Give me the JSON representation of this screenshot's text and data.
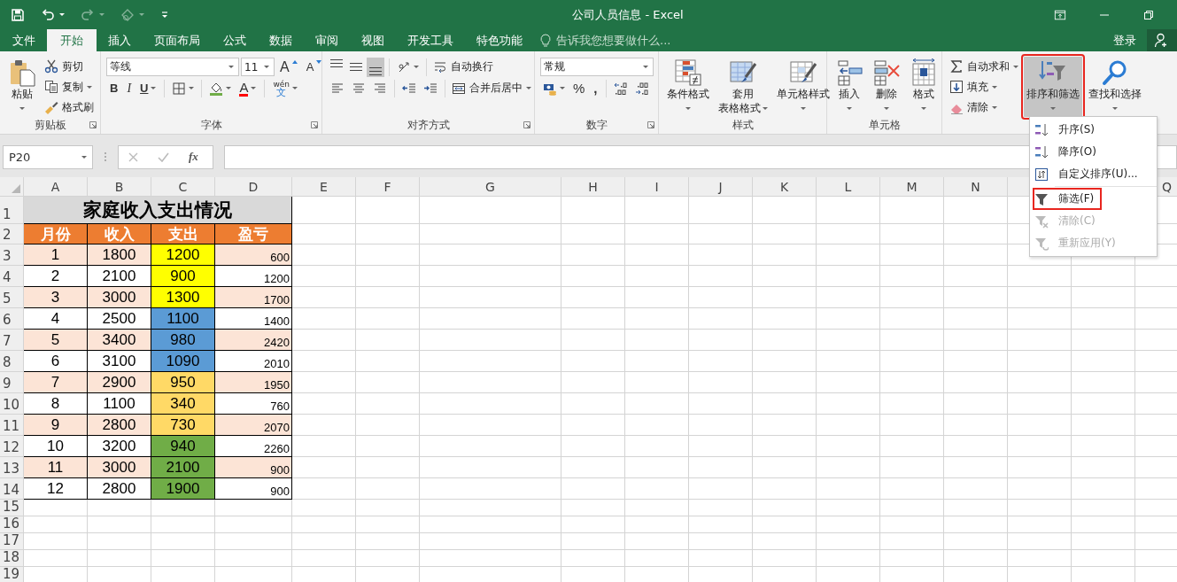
{
  "window": {
    "title": "公司人员信息 - Excel"
  },
  "quick_access": [
    {
      "kind": "save",
      "disabled": false
    },
    {
      "kind": "undo",
      "disabled": false
    },
    {
      "kind": "redo",
      "disabled": true
    },
    {
      "kind": "touch-mode",
      "disabled": true
    },
    {
      "kind": "customize",
      "disabled": false
    }
  ],
  "ribbon_tabs": [
    {
      "label": "文件",
      "selected": false
    },
    {
      "label": "开始",
      "selected": true
    },
    {
      "label": "插入",
      "selected": false
    },
    {
      "label": "页面布局",
      "selected": false
    },
    {
      "label": "公式",
      "selected": false
    },
    {
      "label": "数据",
      "selected": false
    },
    {
      "label": "审阅",
      "selected": false
    },
    {
      "label": "视图",
      "selected": false
    },
    {
      "label": "开发工具",
      "selected": false
    },
    {
      "label": "特色功能",
      "selected": false
    }
  ],
  "tell_me": {
    "placeholder": "告诉我您想要做什么..."
  },
  "account": {
    "sign_in": "登录"
  },
  "ribbon_groups": [
    {
      "label": "剪贴板",
      "launcher": true,
      "columns": [
        [
          [
            {
              "kind": "paste",
              "label": "粘贴",
              "caret": true
            }
          ]
        ],
        [
          [
            {
              "kind": "cut",
              "label": "剪切"
            }
          ],
          [
            {
              "kind": "copy",
              "label": "复制",
              "caret": true
            }
          ],
          [
            {
              "kind": "format-painter",
              "label": "格式刷"
            }
          ]
        ]
      ]
    },
    {
      "label": "字体",
      "launcher": true,
      "columns": [
        [
          [
            {
              "kind": "font-name",
              "value": "等线"
            },
            {
              "kind": "font-size",
              "value": "11"
            },
            {
              "kind": "grow-font",
              "label": "A"
            },
            {
              "kind": "shrink-font",
              "label": "A"
            }
          ],
          [
            {
              "kind": "bold",
              "label": "B"
            },
            {
              "kind": "italic",
              "label": "I"
            },
            {
              "kind": "underline",
              "label": "U",
              "caret": true
            },
            {
              "kind": "separator"
            },
            {
              "kind": "borders",
              "caret": true
            },
            {
              "kind": "separator"
            },
            {
              "kind": "fill-color",
              "caret": true
            },
            {
              "kind": "font-color",
              "label": "A",
              "caret": true
            },
            {
              "kind": "separator"
            },
            {
              "kind": "phonetic",
              "label": "wén",
              "sublabel": "文",
              "caret": true
            }
          ]
        ]
      ]
    },
    {
      "label": "对齐方式",
      "launcher": true,
      "columns": [
        [
          [
            {
              "kind": "align-top",
              "selected": false
            },
            {
              "kind": "align-middle",
              "selected": false
            },
            {
              "kind": "align-bottom",
              "selected": true
            },
            {
              "kind": "separator"
            },
            {
              "kind": "orientation",
              "caret": true
            },
            {
              "kind": "separator"
            },
            {
              "kind": "wrap-text",
              "label": "自动换行"
            }
          ],
          [
            {
              "kind": "align-left",
              "selected": false
            },
            {
              "kind": "align-center",
              "selected": false
            },
            {
              "kind": "align-right",
              "selected": false
            },
            {
              "kind": "separator"
            },
            {
              "kind": "indent-decrease"
            },
            {
              "kind": "indent-increase"
            },
            {
              "kind": "separator"
            },
            {
              "kind": "merge",
              "label": "合并后居中",
              "caret": true
            }
          ]
        ]
      ]
    },
    {
      "label": "数字",
      "launcher": true,
      "columns": [
        [
          [
            {
              "kind": "number-format",
              "value": "常规"
            }
          ],
          [
            {
              "kind": "accounting",
              "caret": true
            },
            {
              "kind": "percent",
              "label": "%"
            },
            {
              "kind": "comma",
              "label": ","
            },
            {
              "kind": "separator"
            },
            {
              "kind": "decimal-increase"
            },
            {
              "kind": "decimal-decrease"
            }
          ]
        ]
      ]
    },
    {
      "label": "样式",
      "columns": [
        [
          [
            {
              "kind": "conditional-format",
              "label": "条件格式",
              "caret": true
            }
          ]
        ],
        [
          [
            {
              "kind": "table-format",
              "label": "套用",
              "label_2": "表格格式",
              "caret": true
            }
          ]
        ],
        [
          [
            {
              "kind": "cell-styles",
              "label": "单元格样式",
              "caret": true
            }
          ]
        ]
      ]
    },
    {
      "label": "单元格",
      "columns": [
        [
          [
            {
              "kind": "insert-cells",
              "label": "插入",
              "caret": true
            }
          ]
        ],
        [
          [
            {
              "kind": "delete-cells",
              "label": "删除",
              "caret": true
            }
          ]
        ],
        [
          [
            {
              "kind": "format-cells",
              "label": "格式",
              "caret": true
            }
          ]
        ]
      ]
    },
    {
      "columns": [
        [
          [
            {
              "kind": "autosum",
              "label": "自动求和",
              "caret": true
            }
          ],
          [
            {
              "kind": "fill",
              "label": "填充",
              "caret": true
            }
          ],
          [
            {
              "kind": "clear",
              "label": "清除",
              "caret": true
            }
          ]
        ],
        [
          [
            {
              "kind": "sort-filter",
              "label": "排序和筛选",
              "caret": true,
              "active": true,
              "highlighted": true
            }
          ]
        ],
        [
          [
            {
              "kind": "find-select",
              "label": "查找和选择",
              "caret": true
            }
          ]
        ]
      ]
    }
  ],
  "formula_bar": {
    "name_box": "P20",
    "function_button": "fx"
  },
  "sheet": {
    "columns": [
      "A",
      "B",
      "C",
      "D",
      "E",
      "F",
      "G",
      "H",
      "I",
      "J",
      "K",
      "L",
      "M",
      "N"
    ],
    "last_column": "Q",
    "row_numbers": [
      "1",
      "2",
      "3",
      "4",
      "5",
      "6",
      "7",
      "8",
      "9",
      "10",
      "11",
      "12",
      "13",
      "14",
      "15",
      "16",
      "17",
      "18",
      "19"
    ],
    "title": "家庭收入支出情况",
    "headers": [
      "月份",
      "收入",
      "支出",
      "盈亏"
    ],
    "rows": [
      {
        "cells": [
          "1",
          "1800",
          "1200",
          "600"
        ],
        "shaded": true,
        "color": "#ffff00"
      },
      {
        "cells": [
          "2",
          "2100",
          "900",
          "1200"
        ],
        "shaded": false,
        "color": "#ffff00"
      },
      {
        "cells": [
          "3",
          "3000",
          "1300",
          "1700"
        ],
        "shaded": true,
        "color": "#ffff00"
      },
      {
        "cells": [
          "4",
          "2500",
          "1100",
          "1400"
        ],
        "shaded": false,
        "color": "#5b9bd5"
      },
      {
        "cells": [
          "5",
          "3400",
          "980",
          "2420"
        ],
        "shaded": true,
        "color": "#5b9bd5"
      },
      {
        "cells": [
          "6",
          "3100",
          "1090",
          "2010"
        ],
        "shaded": false,
        "color": "#5b9bd5"
      },
      {
        "cells": [
          "7",
          "2900",
          "950",
          "1950"
        ],
        "shaded": true,
        "color": "#ffd966"
      },
      {
        "cells": [
          "8",
          "1100",
          "340",
          "760"
        ],
        "shaded": false,
        "color": "#ffd966"
      },
      {
        "cells": [
          "9",
          "2800",
          "730",
          "2070"
        ],
        "shaded": true,
        "color": "#ffd966"
      },
      {
        "cells": [
          "10",
          "3200",
          "940",
          "2260"
        ],
        "shaded": false,
        "color": "#70ad47"
      },
      {
        "cells": [
          "11",
          "3000",
          "2100",
          "900"
        ],
        "shaded": true,
        "color": "#70ad47"
      },
      {
        "cells": [
          "12",
          "2800",
          "1900",
          "900"
        ],
        "shaded": false,
        "color": "#70ad47"
      }
    ]
  },
  "sort_menu": {
    "items": [
      {
        "kind": "sort-ascending",
        "label": "升序(S)",
        "disabled": false
      },
      {
        "kind": "sort-descending",
        "label": "降序(O)",
        "disabled": false
      },
      {
        "kind": "custom-sort",
        "label": "自定义排序(U)...",
        "disabled": false
      },
      {
        "kind": "filter",
        "label": "筛选(F)",
        "disabled": false,
        "divider_before": true,
        "highlighted": true
      },
      {
        "kind": "clear-filter",
        "label": "清除(C)",
        "disabled": true
      },
      {
        "kind": "reapply",
        "label": "重新应用(Y)",
        "disabled": true
      }
    ]
  }
}
